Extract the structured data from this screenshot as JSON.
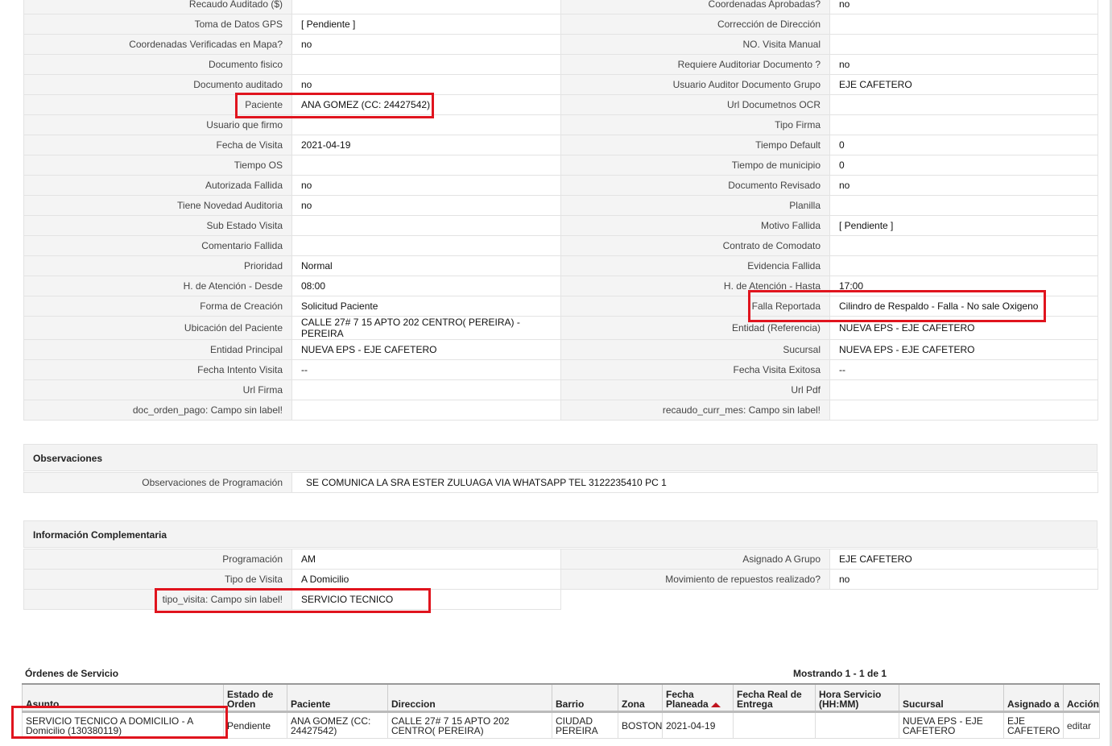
{
  "detail": {
    "partial_row": {
      "left_label": "Recaudo Auditado ($)",
      "left_value": "",
      "right_label": "Coordenadas Aprobadas?",
      "right_value": "no"
    },
    "rows": [
      {
        "left_label": "Toma de Datos GPS",
        "left_value": "[ Pendiente ]",
        "right_label": "Corrección de Dirección",
        "right_value": ""
      },
      {
        "left_label": "Coordenadas Verificadas en Mapa?",
        "left_value": "no",
        "right_label": "NO. Visita Manual",
        "right_value": ""
      },
      {
        "left_label": "Documento fisico",
        "left_value": "",
        "right_label": "Requiere Auditoriar Documento ?",
        "right_value": "no"
      },
      {
        "left_label": "Documento auditado",
        "left_value": "no",
        "right_label": "Usuario Auditor Documento Grupo",
        "right_value": "EJE CAFETERO"
      },
      {
        "left_label": "Paciente",
        "left_value": "ANA GOMEZ (CC: 24427542)",
        "right_label": "Url Documetnos OCR",
        "right_value": ""
      },
      {
        "left_label": "Usuario que firmo",
        "left_value": "",
        "right_label": "Tipo Firma",
        "right_value": ""
      },
      {
        "left_label": "Fecha de Visita",
        "left_value": "2021-04-19",
        "right_label": "Tiempo Default",
        "right_value": "0"
      },
      {
        "left_label": "Tiempo OS",
        "left_value": "",
        "right_label": "Tiempo de municipio",
        "right_value": "0"
      },
      {
        "left_label": "Autorizada Fallida",
        "left_value": "no",
        "right_label": "Documento Revisado",
        "right_value": "no"
      },
      {
        "left_label": "Tiene Novedad Auditoria",
        "left_value": "no",
        "right_label": "Planilla",
        "right_value": ""
      },
      {
        "left_label": "Sub Estado Visita",
        "left_value": "",
        "right_label": "Motivo Fallida",
        "right_value": "[ Pendiente ]"
      },
      {
        "left_label": "Comentario Fallida",
        "left_value": "",
        "right_label": "Contrato de Comodato",
        "right_value": ""
      },
      {
        "left_label": "Prioridad",
        "left_value": "Normal",
        "right_label": "Evidencia Fallida",
        "right_value": ""
      },
      {
        "left_label": "H. de Atención - Desde",
        "left_value": "08:00",
        "right_label": "H. de Atención - Hasta",
        "right_value": "17:00"
      },
      {
        "left_label": "Forma de Creación",
        "left_value": "Solicitud Paciente",
        "right_label": "Falla Reportada",
        "right_value": "Cilindro de Respaldo - Falla - No sale Oxigeno"
      },
      {
        "left_label": "Ubicación del Paciente",
        "left_value": "CALLE 27# 7 15 APTO 202 CENTRO( PEREIRA) - PEREIRA",
        "right_label": "Entidad (Referencia)",
        "right_value": "NUEVA EPS - EJE CAFETERO"
      },
      {
        "left_label": "Entidad Principal",
        "left_value": "NUEVA EPS - EJE CAFETERO",
        "right_label": "Sucursal",
        "right_value": "NUEVA EPS - EJE CAFETERO"
      },
      {
        "left_label": "Fecha Intento Visita",
        "left_value": "--",
        "right_label": "Fecha Visita Exitosa",
        "right_value": "--"
      },
      {
        "left_label": "Url Firma",
        "left_value": "",
        "right_label": "Url Pdf",
        "right_value": ""
      },
      {
        "left_label": "doc_orden_pago: Campo sin label!",
        "left_value": "",
        "right_label": "recaudo_curr_mes: Campo sin label!",
        "right_value": ""
      }
    ]
  },
  "observaciones": {
    "title": "Observaciones",
    "label": "Observaciones de Programación",
    "value": "SE COMUNICA LA SRA ESTER ZULUAGA VIA WHATSAPP TEL 3122235410 PC 1"
  },
  "info": {
    "title": "Información Complementaria",
    "rows": [
      {
        "left_label": "Programación",
        "left_value": "AM",
        "right_label": "Asignado A Grupo",
        "right_value": "EJE CAFETERO"
      },
      {
        "left_label": "Tipo de Visita",
        "left_value": "A Domicilio",
        "right_label": "Movimiento de repuestos realizado?",
        "right_value": "no"
      }
    ],
    "last_row": {
      "label": "tipo_visita: Campo sin label!",
      "value": "SERVICIO TECNICO"
    }
  },
  "orders": {
    "title": "Órdenes de Servicio",
    "count": "Mostrando 1 - 1 de 1",
    "columns": [
      "Asunto",
      "Estado de Orden",
      "Paciente",
      "Direccion",
      "Barrio",
      "Zona",
      "Fecha Planeada",
      "Fecha Real de Entrega",
      "Hora Servicio (HH:MM)",
      "Sucursal",
      "Asignado a",
      "Acción"
    ],
    "rows": [
      {
        "asunto": "SERVICIO TECNICO A DOMICILIO - A Domicilio (130380119)",
        "estado": "Pendiente",
        "paciente": "ANA GOMEZ (CC: 24427542)",
        "direccion": "CALLE 27# 7 15 APTO 202 CENTRO( PEREIRA)",
        "barrio": "CIUDAD PEREIRA",
        "zona": "BOSTON",
        "fecha_planeada": "2021-04-19",
        "fecha_real": "",
        "hora": "",
        "sucursal": "NUEVA EPS - EJE CAFETERO",
        "asignado": "EJE CAFETERO",
        "accion": "editar"
      }
    ]
  },
  "colors": {
    "highlight": "#e0141e",
    "sort_arrow": "#c0141e"
  }
}
